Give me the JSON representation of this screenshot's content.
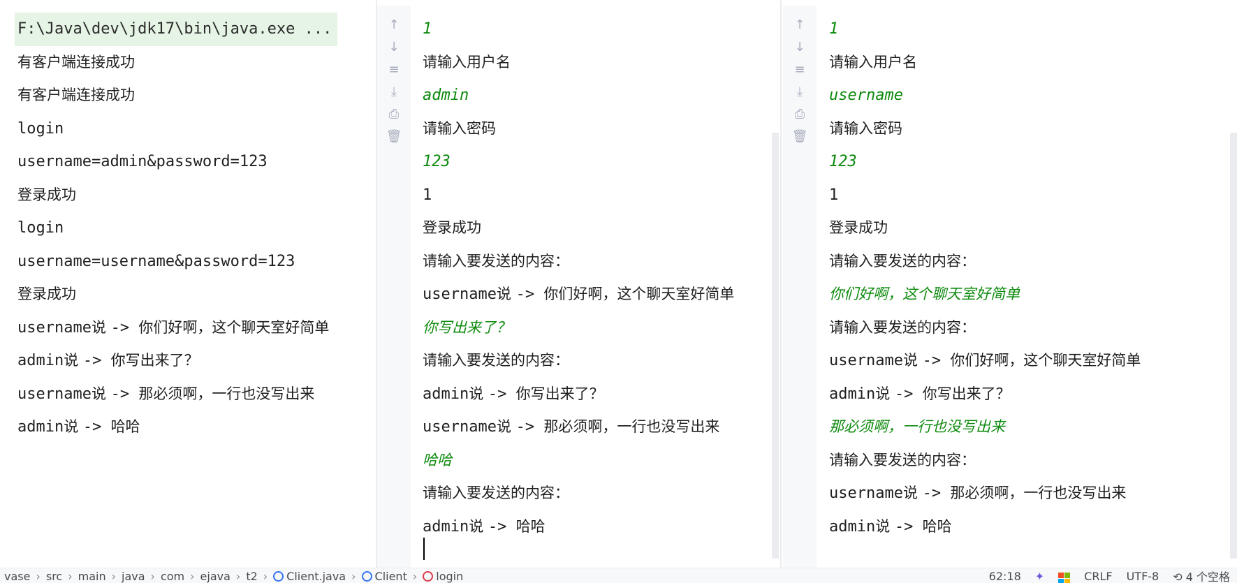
{
  "server_console": {
    "lines": [
      {
        "type": "cmd",
        "parts": [
          {
            "t": "m",
            "v": "F:\\Java\\dev\\jdk17\\bin\\java.exe ..."
          }
        ]
      },
      {
        "type": "out",
        "parts": [
          {
            "t": "c",
            "v": "有客户端连接成功"
          }
        ]
      },
      {
        "type": "out",
        "parts": [
          {
            "t": "c",
            "v": "有客户端连接成功"
          }
        ]
      },
      {
        "type": "out",
        "parts": [
          {
            "t": "m",
            "v": "login"
          }
        ]
      },
      {
        "type": "out",
        "parts": [
          {
            "t": "m",
            "v": "username=admin&password=123"
          }
        ]
      },
      {
        "type": "out",
        "parts": [
          {
            "t": "c",
            "v": "登录成功"
          }
        ]
      },
      {
        "type": "out",
        "parts": [
          {
            "t": "m",
            "v": "login"
          }
        ]
      },
      {
        "type": "out",
        "parts": [
          {
            "t": "m",
            "v": "username=username&password=123"
          }
        ]
      },
      {
        "type": "out",
        "parts": [
          {
            "t": "c",
            "v": "登录成功"
          }
        ]
      },
      {
        "type": "out",
        "parts": [
          {
            "t": "m",
            "v": "username"
          },
          {
            "t": "c",
            "v": "说 "
          },
          {
            "t": "m",
            "v": "-> "
          },
          {
            "t": "c",
            "v": "你们好啊，这个聊天室好简单"
          }
        ]
      },
      {
        "type": "out",
        "parts": [
          {
            "t": "m",
            "v": "admin"
          },
          {
            "t": "c",
            "v": "说 "
          },
          {
            "t": "m",
            "v": "-> "
          },
          {
            "t": "c",
            "v": "你写出来了？"
          }
        ]
      },
      {
        "type": "out",
        "parts": [
          {
            "t": "m",
            "v": "username"
          },
          {
            "t": "c",
            "v": "说 "
          },
          {
            "t": "m",
            "v": "-> "
          },
          {
            "t": "c",
            "v": "那必须啊，一行也没写出来"
          }
        ]
      },
      {
        "type": "out",
        "parts": [
          {
            "t": "m",
            "v": "admin"
          },
          {
            "t": "c",
            "v": "说 "
          },
          {
            "t": "m",
            "v": "-> "
          },
          {
            "t": "c",
            "v": "哈哈"
          }
        ]
      }
    ]
  },
  "client1_console": {
    "lines": [
      {
        "type": "input",
        "parts": [
          {
            "t": "m",
            "v": "1"
          }
        ]
      },
      {
        "type": "out",
        "parts": [
          {
            "t": "c",
            "v": "请输入用户名"
          }
        ]
      },
      {
        "type": "input",
        "parts": [
          {
            "t": "m",
            "v": "admin"
          }
        ]
      },
      {
        "type": "out",
        "parts": [
          {
            "t": "c",
            "v": "请输入密码"
          }
        ]
      },
      {
        "type": "input",
        "parts": [
          {
            "t": "m",
            "v": "123"
          }
        ]
      },
      {
        "type": "out",
        "parts": [
          {
            "t": "m",
            "v": "1"
          }
        ]
      },
      {
        "type": "out",
        "parts": [
          {
            "t": "c",
            "v": "登录成功"
          }
        ]
      },
      {
        "type": "out",
        "parts": [
          {
            "t": "c",
            "v": "请输入要发送的内容："
          }
        ]
      },
      {
        "type": "out",
        "parts": [
          {
            "t": "m",
            "v": "username"
          },
          {
            "t": "c",
            "v": "说 "
          },
          {
            "t": "m",
            "v": "-> "
          },
          {
            "t": "c",
            "v": "你们好啊，这个聊天室好简单"
          }
        ]
      },
      {
        "type": "input",
        "parts": [
          {
            "t": "c",
            "v": "你写出来了？"
          }
        ]
      },
      {
        "type": "out",
        "parts": [
          {
            "t": "c",
            "v": "请输入要发送的内容："
          }
        ]
      },
      {
        "type": "out",
        "parts": [
          {
            "t": "m",
            "v": "admin"
          },
          {
            "t": "c",
            "v": "说 "
          },
          {
            "t": "m",
            "v": "-> "
          },
          {
            "t": "c",
            "v": "你写出来了？"
          }
        ]
      },
      {
        "type": "out",
        "parts": [
          {
            "t": "m",
            "v": "username"
          },
          {
            "t": "c",
            "v": "说 "
          },
          {
            "t": "m",
            "v": "-> "
          },
          {
            "t": "c",
            "v": "那必须啊，一行也没写出来"
          }
        ]
      },
      {
        "type": "input",
        "parts": [
          {
            "t": "c",
            "v": "哈哈"
          }
        ]
      },
      {
        "type": "out",
        "parts": [
          {
            "t": "c",
            "v": "请输入要发送的内容："
          }
        ]
      },
      {
        "type": "out",
        "parts": [
          {
            "t": "m",
            "v": "admin"
          },
          {
            "t": "c",
            "v": "说 "
          },
          {
            "t": "m",
            "v": "-> "
          },
          {
            "t": "c",
            "v": "哈哈"
          }
        ]
      }
    ]
  },
  "client2_console": {
    "lines": [
      {
        "type": "input",
        "parts": [
          {
            "t": "m",
            "v": "1"
          }
        ]
      },
      {
        "type": "out",
        "parts": [
          {
            "t": "c",
            "v": "请输入用户名"
          }
        ]
      },
      {
        "type": "input",
        "parts": [
          {
            "t": "m",
            "v": "username"
          }
        ]
      },
      {
        "type": "out",
        "parts": [
          {
            "t": "c",
            "v": "请输入密码"
          }
        ]
      },
      {
        "type": "input",
        "parts": [
          {
            "t": "m",
            "v": "123"
          }
        ]
      },
      {
        "type": "out",
        "parts": [
          {
            "t": "m",
            "v": "1"
          }
        ]
      },
      {
        "type": "out",
        "parts": [
          {
            "t": "c",
            "v": "登录成功"
          }
        ]
      },
      {
        "type": "out",
        "parts": [
          {
            "t": "c",
            "v": "请输入要发送的内容："
          }
        ]
      },
      {
        "type": "input",
        "parts": [
          {
            "t": "c",
            "v": "你们好啊，这个聊天室好简单"
          }
        ]
      },
      {
        "type": "out",
        "parts": [
          {
            "t": "c",
            "v": "请输入要发送的内容："
          }
        ]
      },
      {
        "type": "out",
        "parts": [
          {
            "t": "m",
            "v": "username"
          },
          {
            "t": "c",
            "v": "说 "
          },
          {
            "t": "m",
            "v": "-> "
          },
          {
            "t": "c",
            "v": "你们好啊，这个聊天室好简单"
          }
        ]
      },
      {
        "type": "out",
        "parts": [
          {
            "t": "m",
            "v": "admin"
          },
          {
            "t": "c",
            "v": "说 "
          },
          {
            "t": "m",
            "v": "-> "
          },
          {
            "t": "c",
            "v": "你写出来了？"
          }
        ]
      },
      {
        "type": "input",
        "parts": [
          {
            "t": "c",
            "v": "那必须啊，一行也没写出来"
          }
        ]
      },
      {
        "type": "out",
        "parts": [
          {
            "t": "c",
            "v": "请输入要发送的内容："
          }
        ]
      },
      {
        "type": "out",
        "parts": [
          {
            "t": "m",
            "v": "username"
          },
          {
            "t": "c",
            "v": "说 "
          },
          {
            "t": "m",
            "v": "-> "
          },
          {
            "t": "c",
            "v": "那必须啊，一行也没写出来"
          }
        ]
      },
      {
        "type": "out",
        "parts": [
          {
            "t": "m",
            "v": "admin"
          },
          {
            "t": "c",
            "v": "说 "
          },
          {
            "t": "m",
            "v": "-> "
          },
          {
            "t": "c",
            "v": "哈哈"
          }
        ]
      }
    ]
  },
  "toolbar_icons": [
    "arrow-up-icon",
    "arrow-down-icon",
    "soft-wrap-icon",
    "scroll-to-end-icon",
    "print-icon",
    "trash-icon"
  ],
  "breadcrumbs": [
    "vase",
    "src",
    "main",
    "java",
    "com",
    "ejava",
    "t2",
    "Client.java",
    "Client",
    "login"
  ],
  "status": {
    "position": "62:18",
    "line_ending": "CRLF",
    "encoding": "UTF-8",
    "indent": "4 个空格"
  },
  "colors": {
    "input_text": "#0d8a0d",
    "cmd_highlight": "#e6f4e6",
    "toolbar_icon": "#a8adbd"
  }
}
